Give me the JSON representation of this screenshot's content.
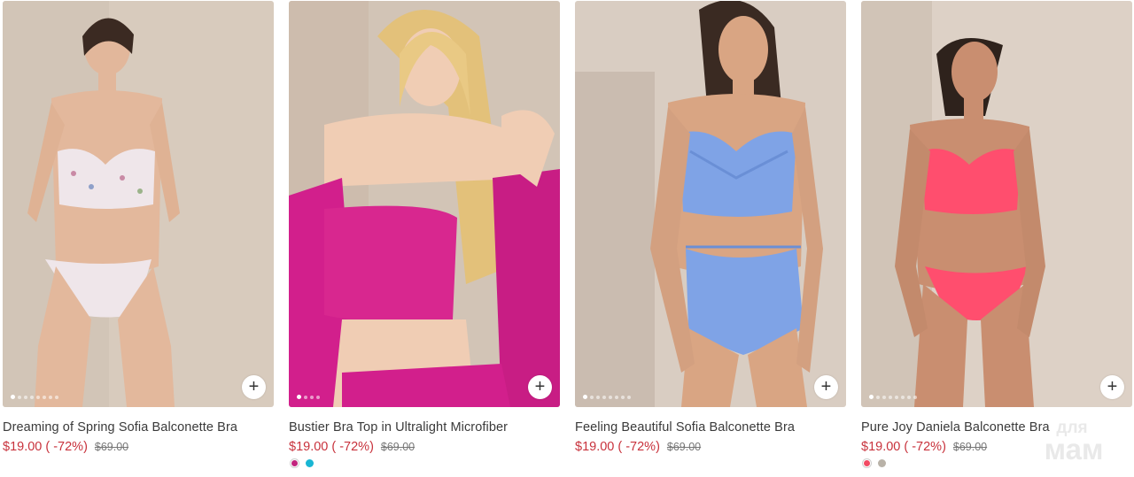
{
  "products": [
    {
      "name": "Dreaming of Spring Sofia Balconette Bra",
      "price": "$19.00",
      "discount": "( -72%)",
      "old_price": "$69.00",
      "photo_bg": "#d8cbbd",
      "garment_color": "#efe6ea",
      "swatches": []
    },
    {
      "name": "Bustier Bra Top in Ultralight Microfiber",
      "price": "$19.00",
      "discount": "( -72%)",
      "old_price": "$69.00",
      "photo_bg": "#d2c4b6",
      "garment_color": "#d21f8c",
      "swatches": [
        "#c2247e",
        "#19b6d4"
      ]
    },
    {
      "name": "Feeling Beautiful Sofia Balconette Bra",
      "price": "$19.00",
      "discount": "( -72%)",
      "old_price": "$69.00",
      "photo_bg": "#d9cdc2",
      "garment_color": "#7fa3e6",
      "swatches": []
    },
    {
      "name": "Pure Joy Daniela Balconette Bra",
      "price": "$19.00",
      "discount": "( -72%)",
      "old_price": "$69.00",
      "photo_bg": "#ddd1c6",
      "garment_color": "#ff4e6e",
      "swatches": [
        "#f24a63",
        "#b9b2a8"
      ]
    }
  ],
  "watermark": {
    "line1": "для",
    "line2": "мам"
  },
  "colors": {
    "sale_red": "#c8323c",
    "text": "#3a3a3a"
  }
}
